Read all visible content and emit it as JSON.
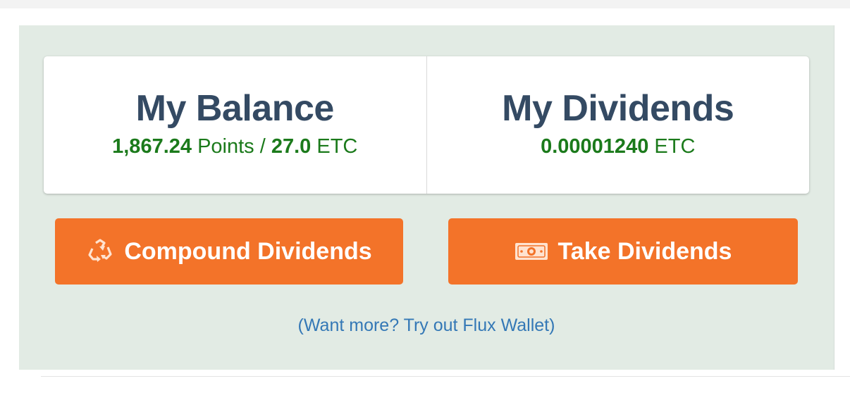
{
  "balance": {
    "title": "My Balance",
    "points": "1,867.24",
    "points_unit": "Points /",
    "etc": "27.0",
    "etc_unit": "ETC"
  },
  "dividends": {
    "title": "My Dividends",
    "amount": "0.00001240",
    "unit": "ETC"
  },
  "actions": {
    "compound_label": "Compound Dividends",
    "compound_icon": "recycle-icon",
    "take_label": "Take Dividends",
    "take_icon": "banknote-icon"
  },
  "promo_link": "(Want more? Try out Flux Wallet)",
  "colors": {
    "accent": "#f37329",
    "title": "#344a63",
    "value_green": "#1b7a1b",
    "link": "#3478b6",
    "panel_bg": "#e2ebe4"
  }
}
